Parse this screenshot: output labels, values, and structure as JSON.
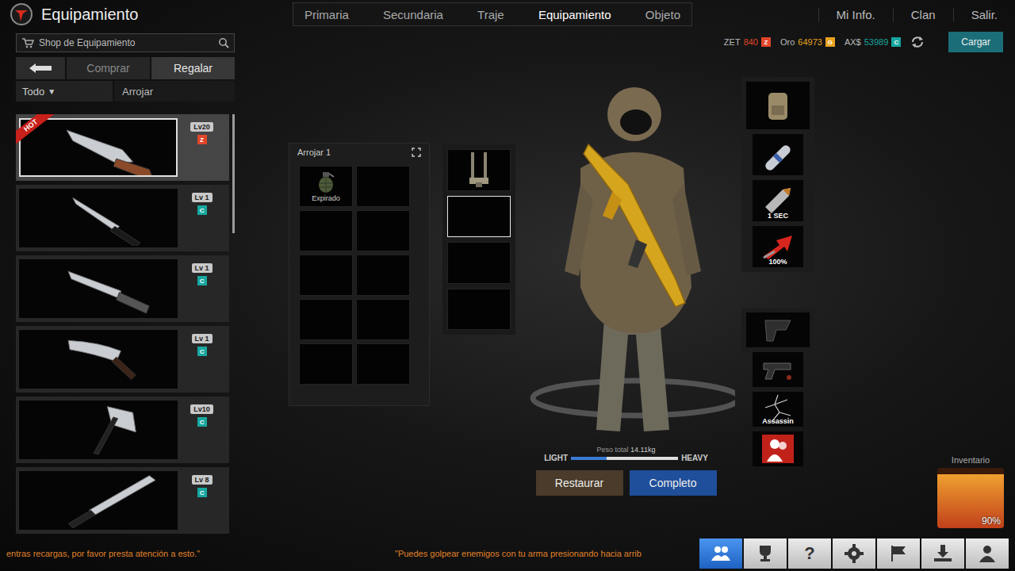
{
  "header": {
    "title": "Equipamiento",
    "nav": [
      {
        "label": "Primaria",
        "selected": false
      },
      {
        "label": "Secundaria",
        "selected": false
      },
      {
        "label": "Traje",
        "selected": false
      },
      {
        "label": "Equipamiento",
        "selected": true
      },
      {
        "label": "Objeto",
        "selected": false
      }
    ],
    "links": [
      "Mi Info.",
      "Clan",
      "Salir."
    ]
  },
  "currency": [
    {
      "label": "ZET",
      "value": "840",
      "badge": "Z",
      "color": "#e0452a"
    },
    {
      "label": "Oro",
      "value": "64973",
      "badge": "G",
      "color": "#e8a21d"
    },
    {
      "label": "AX$",
      "value": "53989",
      "badge": "C",
      "color": "#17a7a0"
    }
  ],
  "load_button": "Cargar",
  "shop": {
    "search": "Shop de Equipamiento",
    "actions": [
      {
        "label": "Comprar",
        "selected": false
      },
      {
        "label": "Regalar",
        "selected": true
      }
    ],
    "filter": {
      "value": "Todo",
      "arrow": "▼"
    },
    "category": "Arrojar",
    "items": [
      {
        "kind": "hunting-knife",
        "tag": "HOT",
        "level": "Lv20",
        "currency": "Z",
        "color": "#e0452a",
        "selected": true
      },
      {
        "kind": "bayonet",
        "tag": "",
        "level": "Lv 1",
        "currency": "C",
        "color": "#17a7a0",
        "selected": false
      },
      {
        "kind": "blade",
        "tag": "",
        "level": "Lv 1",
        "currency": "C",
        "color": "#17a7a0",
        "selected": false
      },
      {
        "kind": "kukri",
        "tag": "",
        "level": "Lv 1",
        "currency": "C",
        "color": "#17a7a0",
        "selected": false
      },
      {
        "kind": "axe",
        "tag": "",
        "level": "Lv10",
        "currency": "C",
        "color": "#17a7a0",
        "selected": false
      },
      {
        "kind": "machete",
        "tag": "",
        "level": "Lv 8",
        "currency": "C",
        "color": "#17a7a0",
        "selected": false
      }
    ]
  },
  "loadout": {
    "title": "Arrojar 1",
    "slots": [
      {
        "kind": "grenade",
        "label": "Expirado"
      },
      {
        "kind": "empty",
        "label": ""
      },
      {
        "kind": "empty",
        "label": ""
      },
      {
        "kind": "empty",
        "label": ""
      },
      {
        "kind": "empty",
        "label": ""
      },
      {
        "kind": "empty",
        "label": ""
      },
      {
        "kind": "empty",
        "label": ""
      },
      {
        "kind": "empty",
        "label": ""
      },
      {
        "kind": "empty",
        "label": ""
      },
      {
        "kind": "empty",
        "label": ""
      }
    ]
  },
  "side_slots": [
    {
      "kind": "vest",
      "selected": false
    },
    {
      "kind": "empty",
      "selected": true
    },
    {
      "kind": "empty",
      "selected": false
    },
    {
      "kind": "empty",
      "selected": false
    }
  ],
  "weight": {
    "label": "Peso total",
    "value": "14.11kg",
    "min": "LIGHT",
    "max": "HEAVY",
    "level": 0.33
  },
  "buttons": [
    {
      "label": "Restaurar",
      "kind": "secondary"
    },
    {
      "label": "Completo",
      "kind": "primary"
    }
  ],
  "perks_top": [
    {
      "kind": "backpack",
      "label": ""
    },
    {
      "kind": "pill",
      "label": ""
    },
    {
      "kind": "bullet",
      "label": "1 SEC"
    },
    {
      "kind": "arrow",
      "label": "100%"
    }
  ],
  "perks_bottom": [
    {
      "kind": "holster",
      "label": ""
    },
    {
      "kind": "pistol",
      "label": ""
    },
    {
      "kind": "cracks",
      "label": "Assassin"
    },
    {
      "kind": "silhouette",
      "label": ""
    }
  ],
  "inventory": {
    "title": "Inventario",
    "level": 0.9,
    "reading": "90%"
  },
  "ticker": [
    "entras recargas, por favor presta atención a esto.\"",
    "\"Puedes golpear enemigos con tu arma presionando hacia arrib"
  ],
  "toolbar": [
    {
      "kind": "friends",
      "label": "",
      "selected": true
    },
    {
      "kind": "trophy",
      "label": "",
      "selected": false
    },
    {
      "kind": "help",
      "label": "?",
      "selected": false
    },
    {
      "kind": "settings",
      "label": "",
      "selected": false
    },
    {
      "kind": "flag",
      "label": "",
      "selected": false
    },
    {
      "kind": "download",
      "label": "",
      "selected": false
    },
    {
      "kind": "profile",
      "label": "",
      "selected": false
    }
  ]
}
